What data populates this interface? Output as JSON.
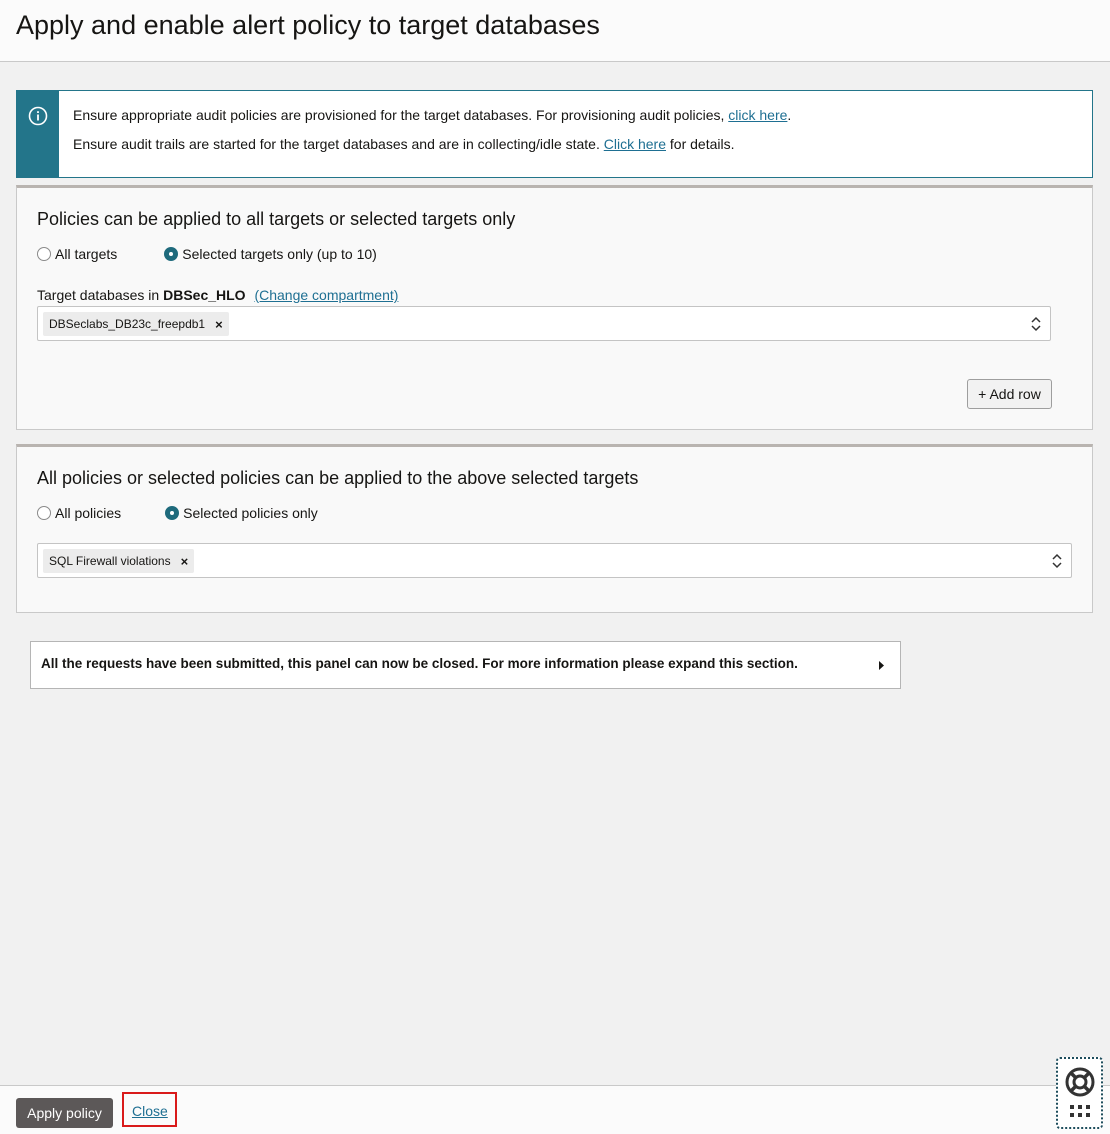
{
  "page": {
    "title": "Apply and enable alert policy to target databases"
  },
  "info": {
    "line1_text": "Ensure appropriate audit policies are provisioned for the target databases. For provisioning audit policies, ",
    "line1_link": "click here",
    "line1_suffix": ".",
    "line2_text": "Ensure audit trails are started for the target databases and are in collecting/idle state. ",
    "line2_link": "Click here",
    "line2_suffix": " for details.",
    "icon": "info-icon"
  },
  "targets_section": {
    "title": "Policies can be applied to all targets or selected targets only",
    "radio_all": "All targets",
    "radio_selected": "Selected targets only (up to 10)",
    "selected": "selected",
    "field_label_prefix": "Target databases in ",
    "compartment": "DBSec_HLO",
    "change_link": "(Change compartment)",
    "chip": "DBSeclabs_DB23c_freepdb1",
    "chip_remove": "×",
    "add_row": "+ Add row"
  },
  "policies_section": {
    "title": "All policies or selected policies can be applied to the above selected targets",
    "radio_all": "All policies",
    "radio_selected": "Selected policies only",
    "selected": "selected",
    "chip": "SQL Firewall violations",
    "chip_remove": "×"
  },
  "status": {
    "message": "All the requests have been submitted, this panel can now be closed. For more information please expand this section."
  },
  "footer": {
    "apply_label": "Apply policy",
    "close_label": "Close"
  },
  "colors": {
    "accent": "#23758a",
    "link": "#1e6f92",
    "primary_button": "#5c5858",
    "highlight_border": "#d91a1a"
  }
}
